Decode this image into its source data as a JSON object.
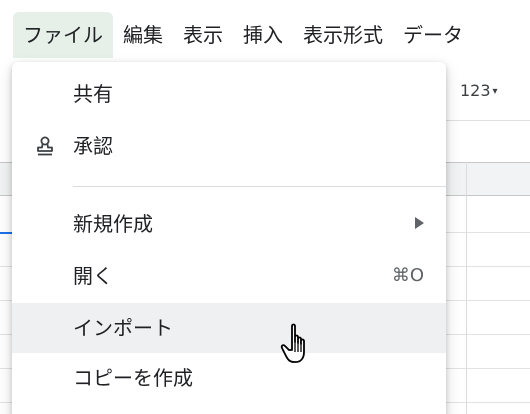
{
  "menubar": {
    "items": [
      {
        "label": "ファイル",
        "active": true
      },
      {
        "label": "編集",
        "active": false
      },
      {
        "label": "表示",
        "active": false
      },
      {
        "label": "挿入",
        "active": false
      },
      {
        "label": "表示形式",
        "active": false
      },
      {
        "label": "データ",
        "active": false
      }
    ]
  },
  "toolbar": {
    "number_format_label": "123",
    "number_format_arrow": "▾"
  },
  "file_menu": {
    "items": [
      {
        "label": "共有",
        "icon": null,
        "shortcut": "",
        "submenu": false
      },
      {
        "label": "承認",
        "icon": "stamp-icon",
        "shortcut": "",
        "submenu": false
      },
      {
        "label": "新規作成",
        "icon": null,
        "shortcut": "",
        "submenu": true
      },
      {
        "label": "開く",
        "icon": null,
        "shortcut": "⌘O",
        "submenu": false
      },
      {
        "label": "インポート",
        "icon": null,
        "shortcut": "",
        "submenu": false,
        "hovered": true
      },
      {
        "label": "コピーを作成",
        "icon": null,
        "shortcut": "",
        "submenu": false
      }
    ]
  },
  "colors": {
    "active_menu_bg": "#e6f0e8",
    "hover_bg": "#eef0f1",
    "text": "#202124",
    "muted_text": "#5f6368",
    "accent": "#1a73e8"
  }
}
